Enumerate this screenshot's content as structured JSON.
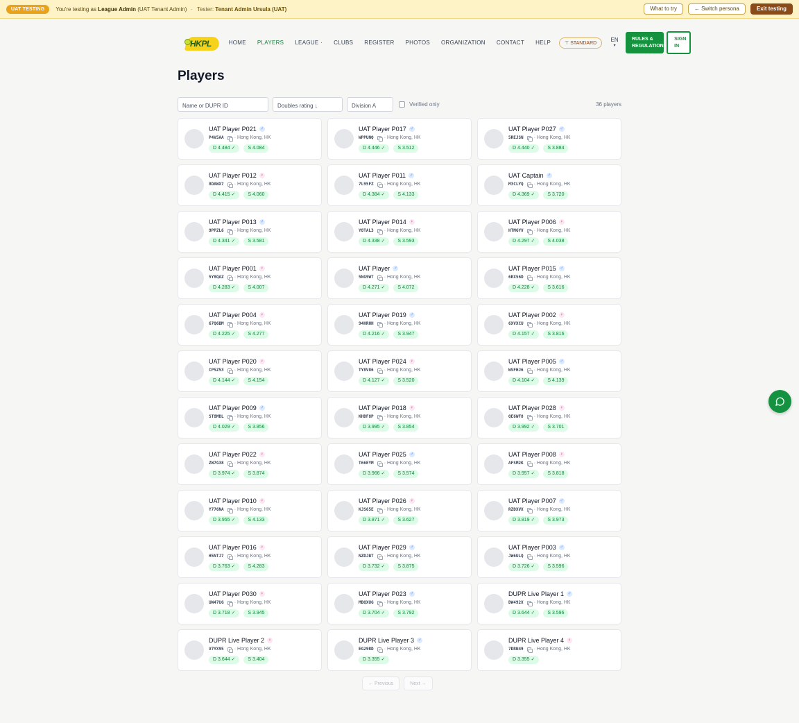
{
  "uat": {
    "tag": "UAT TESTING",
    "prefix": "You're testing as ",
    "role": "League Admin",
    "role_suffix": " (UAT Tenant Admin)",
    "sep": "·",
    "tester_prefix": "Tester: ",
    "tester": "Tenant Admin Ursula (UAT)",
    "what_to_try": "What to try",
    "switch_persona": "← Switch persona",
    "exit": "Exit testing"
  },
  "nav": {
    "logo_text": "HKPL",
    "items": [
      "HOME",
      "PLAYERS",
      "LEAGUE ·",
      "CLUBS",
      "REGISTER",
      "PHOTOS",
      "ORGANIZATION",
      "CONTACT",
      "HELP"
    ],
    "standard": "⊤ STANDARD",
    "lang": "EN",
    "lang_caret": "▾",
    "rules_line1": "RULES &",
    "rules_line2": "REGULATION",
    "signin_line1": "SIGN",
    "signin_line2": "IN"
  },
  "page": {
    "title": "Players"
  },
  "filters": {
    "name_placeholder": "Name or DUPR ID",
    "sort_value": "Doubles rating ↓",
    "division_value": "Division A",
    "verified_label": "Verified only",
    "count": "36 players"
  },
  "players": [
    {
      "name": "UAT Player P021",
      "g": "m",
      "id": "P4V5AA",
      "loc": "· Hong Kong, HK",
      "d": "D 4.484 ✓",
      "s": "S 4.084"
    },
    {
      "name": "UAT Player P017",
      "g": "m",
      "id": "WPPUNQ",
      "loc": "· Hong Kong, HK",
      "d": "D 4.446 ✓",
      "s": "S 3.512"
    },
    {
      "name": "UAT Player P027",
      "g": "m",
      "id": "5REJSN",
      "loc": "· Hong Kong, HK",
      "d": "D 4.440 ✓",
      "s": "S 3.884"
    },
    {
      "name": "UAT Player P012",
      "g": "f",
      "id": "8DAWX7",
      "loc": "· Hong Kong, HK",
      "d": "D 4.415 ✓",
      "s": "S 4.060"
    },
    {
      "name": "UAT Player P011",
      "g": "m",
      "id": "7L95FZ",
      "loc": "· Hong Kong, HK",
      "d": "D 4.384 ✓",
      "s": "S 4.133"
    },
    {
      "name": "UAT Captain",
      "g": "m",
      "id": "M3CLYQ",
      "loc": "· Hong Kong, HK",
      "d": "D 4.369 ✓",
      "s": "S 3.720"
    },
    {
      "name": "UAT Player P013",
      "g": "m",
      "id": "9PPZL6",
      "loc": "· Hong Kong, HK",
      "d": "D 4.341 ✓",
      "s": "S 3.581"
    },
    {
      "name": "UAT Player P014",
      "g": "f",
      "id": "Y8TAL3",
      "loc": "· Hong Kong, HK",
      "d": "D 4.338 ✓",
      "s": "S 3.593"
    },
    {
      "name": "UAT Player P006",
      "g": "f",
      "id": "HTMGYV",
      "loc": "· Hong Kong, HK",
      "d": "D 4.297 ✓",
      "s": "S 4.038"
    },
    {
      "name": "UAT Player P001",
      "g": "f",
      "id": "5Y8QAZ",
      "loc": "· Hong Kong, HK",
      "d": "D 4.283 ✓",
      "s": "S 4.007"
    },
    {
      "name": "UAT Player",
      "g": "m",
      "id": "5NG9WT",
      "loc": "· Hong Kong, HK",
      "d": "D 4.271 ✓",
      "s": "S 4.072"
    },
    {
      "name": "UAT Player P015",
      "g": "m",
      "id": "6RX56D",
      "loc": "· Hong Kong, HK",
      "d": "D 4.228 ✓",
      "s": "S 3.616"
    },
    {
      "name": "UAT Player P004",
      "g": "f",
      "id": "67Q6BM",
      "loc": "· Hong Kong, HK",
      "d": "D 4.225 ✓",
      "s": "S 4.277"
    },
    {
      "name": "UAT Player P019",
      "g": "m",
      "id": "94HRHH",
      "loc": "· Hong Kong, HK",
      "d": "D 4.216 ✓",
      "s": "S 3.947"
    },
    {
      "name": "UAT Player P002",
      "g": "f",
      "id": "6XVXCU",
      "loc": "· Hong Kong, HK",
      "d": "D 4.157 ✓",
      "s": "S 3.816"
    },
    {
      "name": "UAT Player P020",
      "g": "f",
      "id": "CP5Z53",
      "loc": "· Hong Kong, HK",
      "d": "D 4.144 ✓",
      "s": "S 4.154"
    },
    {
      "name": "UAT Player P024",
      "g": "f",
      "id": "TY8V86",
      "loc": "· Hong Kong, HK",
      "d": "D 4.127 ✓",
      "s": "S 3.520"
    },
    {
      "name": "UAT Player P005",
      "g": "m",
      "id": "WSFHJ6",
      "loc": "· Hong Kong, HK",
      "d": "D 4.104 ✓",
      "s": "S 4.139"
    },
    {
      "name": "UAT Player P009",
      "g": "m",
      "id": "ST8MDL",
      "loc": "· Hong Kong, HK",
      "d": "D 4.029 ✓",
      "s": "S 3.856"
    },
    {
      "name": "UAT Player P018",
      "g": "f",
      "id": "KHDF8P",
      "loc": "· Hong Kong, HK",
      "d": "D 3.995 ✓",
      "s": "S 3.854"
    },
    {
      "name": "UAT Player P028",
      "g": "f",
      "id": "QE6WF8",
      "loc": "· Hong Kong, HK",
      "d": "D 3.992 ✓",
      "s": "S 3.701"
    },
    {
      "name": "UAT Player P022",
      "g": "f",
      "id": "ZW7G38",
      "loc": "· Hong Kong, HK",
      "d": "D 3.974 ✓",
      "s": "S 3.874"
    },
    {
      "name": "UAT Player P025",
      "g": "m",
      "id": "T66EYM",
      "loc": "· Hong Kong, HK",
      "d": "D 3.966 ✓",
      "s": "S 3.574"
    },
    {
      "name": "UAT Player P008",
      "g": "f",
      "id": "AFSM2K",
      "loc": "· Hong Kong, HK",
      "d": "D 3.957 ✓",
      "s": "S 3.818"
    },
    {
      "name": "UAT Player P010",
      "g": "f",
      "id": "Y776NA",
      "loc": "· Hong Kong, HK",
      "d": "D 3.955 ✓",
      "s": "S 4.133"
    },
    {
      "name": "UAT Player P026",
      "g": "f",
      "id": "KJS65E",
      "loc": "· Hong Kong, HK",
      "d": "D 3.871 ✓",
      "s": "S 3.627"
    },
    {
      "name": "UAT Player P007",
      "g": "m",
      "id": "RZDXVX",
      "loc": "· Hong Kong, HK",
      "d": "D 3.819 ✓",
      "s": "S 3.973"
    },
    {
      "name": "UAT Player P016",
      "g": "f",
      "id": "H5NTJ7",
      "loc": "· Hong Kong, HK",
      "d": "D 3.763 ✓",
      "s": "S 4.283"
    },
    {
      "name": "UAT Player P029",
      "g": "m",
      "id": "NZDJBT",
      "loc": "· Hong Kong, HK",
      "d": "D 3.732 ✓",
      "s": "S 3.875"
    },
    {
      "name": "UAT Player P003",
      "g": "m",
      "id": "JW6ULQ",
      "loc": "· Hong Kong, HK",
      "d": "D 3.726 ✓",
      "s": "S 3.596"
    },
    {
      "name": "UAT Player P030",
      "g": "f",
      "id": "UW47UG",
      "loc": "· Hong Kong, HK",
      "d": "D 3.718 ✓",
      "s": "S 3.945"
    },
    {
      "name": "UAT Player P023",
      "g": "m",
      "id": "MBQXUG",
      "loc": "· Hong Kong, HK",
      "d": "D 3.704 ✓",
      "s": "S 3.792"
    },
    {
      "name": "DUPR Live Player 1",
      "g": "m",
      "id": "DW492X",
      "loc": "· Hong Kong, HK",
      "d": "D 3.644 ✓",
      "s": "S 3.596"
    },
    {
      "name": "DUPR Live Player 2",
      "g": "f",
      "id": "V7YX95",
      "loc": "· Hong Kong, HK",
      "d": "D 3.644 ✓",
      "s": "S 3.404"
    },
    {
      "name": "DUPR Live Player 3",
      "g": "m",
      "id": "EG29RD",
      "loc": "· Hong Kong, HK",
      "d": "D 3.355 ✓",
      "s": ""
    },
    {
      "name": "DUPR Live Player 4",
      "g": "f",
      "id": "7DRN49",
      "loc": "· Hong Kong, HK",
      "d": "D 3.355 ✓",
      "s": ""
    }
  ],
  "pager": {
    "prev": "← Previous",
    "next": "Next →"
  },
  "colors": {
    "brand_green": "#14923e",
    "banner": "#fdf3c7",
    "pill_bg": "#dcfce7"
  }
}
